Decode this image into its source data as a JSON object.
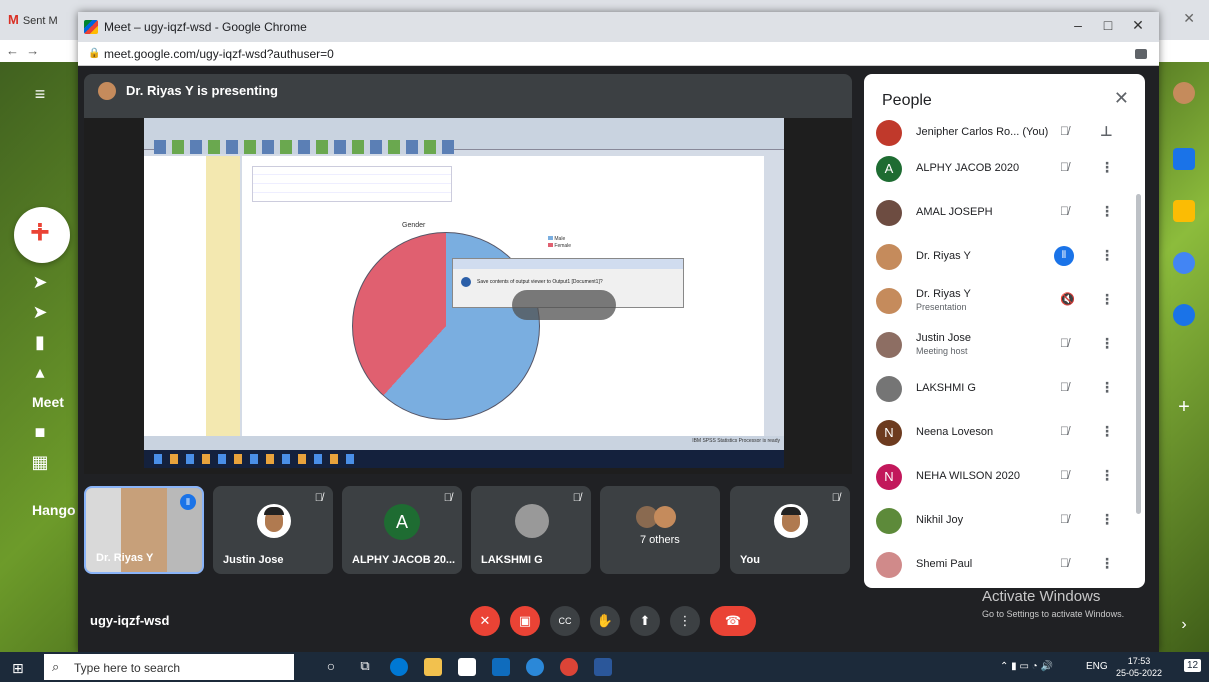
{
  "background": {
    "gmail_tab": "Sent M",
    "meet_label": "Meet",
    "hangouts_label": "Hango"
  },
  "window": {
    "title": "Meet – ugy-iqzf-wsd - Google Chrome",
    "url": "meet.google.com/ugy-iqzf-wsd?authuser=0",
    "minimize": "–",
    "maximize": "□",
    "close": "✕"
  },
  "presenting": {
    "text": "Dr. Riyas Y is presenting"
  },
  "shared_screen": {
    "chart_title": "Gender",
    "legend": [
      "Male",
      "Female"
    ],
    "dialog_text": "Save contents of output viewer to Output1 [Document1]?",
    "status_text": "IBM SPSS Statistics Processor is ready"
  },
  "tiles": [
    {
      "name": "Dr. Riyas Y",
      "speaking": true
    },
    {
      "name": "Justin Jose"
    },
    {
      "name": "ALPHY JACOB 20...",
      "initial": "A"
    },
    {
      "name": "LAKSHMI G"
    },
    {
      "name": "7 others"
    },
    {
      "name": "You"
    }
  ],
  "meeting_code": "ugy-iqzf-wsd",
  "controls": {
    "mic": "mic-off",
    "camera": "camera-off",
    "captions": "CC",
    "hand": "raise-hand",
    "present": "present",
    "more": "more",
    "end": "end-call"
  },
  "people": {
    "title": "People",
    "close": "✕",
    "list": [
      {
        "name": "Jenipher Carlos Ro... (You)",
        "sub": "",
        "color": "#c0392b"
      },
      {
        "name": "ALPHY JACOB 2020",
        "sub": "",
        "initial": "A",
        "color": "#1e6c32"
      },
      {
        "name": "AMAL JOSEPH",
        "sub": "",
        "color": "#6d4c41"
      },
      {
        "name": "Dr. Riyas Y",
        "sub": "",
        "color": "#c58b5c",
        "speaking": true
      },
      {
        "name": "Dr. Riyas Y",
        "sub": "Presentation",
        "color": "#c58b5c"
      },
      {
        "name": "Justin Jose",
        "sub": "Meeting host",
        "color": "#8d6e63"
      },
      {
        "name": "LAKSHMI G",
        "sub": "",
        "color": "#757575"
      },
      {
        "name": "Neena Loveson",
        "sub": "",
        "initial": "N",
        "color": "#6d3b1f"
      },
      {
        "name": "NEHA WILSON 2020",
        "sub": "",
        "initial": "N",
        "color": "#c2185b"
      },
      {
        "name": "Nikhil Joy",
        "sub": "",
        "color": "#5d8a3a"
      },
      {
        "name": "Shemi Paul",
        "sub": "",
        "color": "#d08a8a"
      }
    ]
  },
  "activate_windows": {
    "title": "Activate Windows",
    "subtitle": "Go to Settings to activate Windows."
  },
  "taskbar": {
    "search_placeholder": "Type here to search",
    "lang": "ENG",
    "time": "17:53",
    "date": "25-05-2022",
    "notifications": "12"
  }
}
